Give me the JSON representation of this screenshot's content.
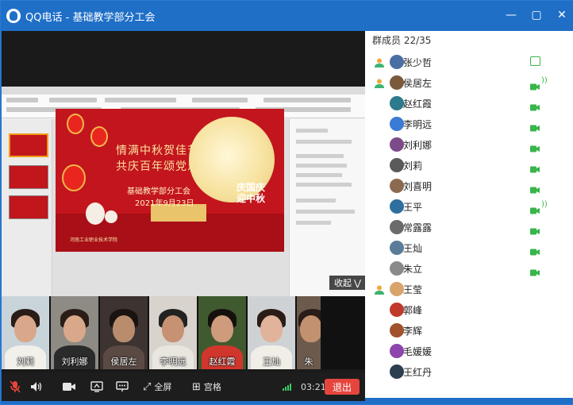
{
  "window": {
    "app_name": "QQ电话",
    "separator": " - ",
    "group_name": "基础教学部分工会"
  },
  "slide": {
    "line1": "情满中秋贺佳节",
    "line2": "共庆百年颂党恩",
    "line3": "基础教学部分工会",
    "line4": "2021年9月23日",
    "stamp": "庆国庆 迎中秋",
    "footer": "河南工业职业技术学院"
  },
  "share": {
    "collapse_label": "收起"
  },
  "video_tiles": [
    {
      "name": "刘莉"
    },
    {
      "name": "刘利娜"
    },
    {
      "name": "侯居左"
    },
    {
      "name": "李明远"
    },
    {
      "name": "赵红霞"
    },
    {
      "name": "王灿"
    },
    {
      "name": "朱"
    }
  ],
  "toolbar": {
    "fullscreen_label": "全屏",
    "grid_label": "宫格",
    "timer": "03:21",
    "exit_label": "退出"
  },
  "members": {
    "header": "群成员 22/35",
    "list": [
      {
        "name": "张少哲",
        "role": "admin",
        "status": "screen"
      },
      {
        "name": "侯居左",
        "role": "admin",
        "status": "cam-speaking"
      },
      {
        "name": "赵红霞",
        "role": "",
        "status": "cam"
      },
      {
        "name": "李明远",
        "role": "",
        "status": "cam"
      },
      {
        "name": "刘利娜",
        "role": "",
        "status": "cam"
      },
      {
        "name": "刘莉",
        "role": "",
        "status": "cam"
      },
      {
        "name": "刘喜明",
        "role": "",
        "status": "cam"
      },
      {
        "name": "王平",
        "role": "",
        "status": "cam-speaking"
      },
      {
        "name": "常露露",
        "role": "",
        "status": "cam"
      },
      {
        "name": "王灿",
        "role": "",
        "status": "cam"
      },
      {
        "name": "朱立",
        "role": "",
        "status": "cam"
      },
      {
        "name": "王莹",
        "role": "admin",
        "status": ""
      },
      {
        "name": "郭峰",
        "role": "",
        "status": ""
      },
      {
        "name": "李辉",
        "role": "",
        "status": ""
      },
      {
        "name": "毛媛媛",
        "role": "",
        "status": ""
      },
      {
        "name": "王红丹",
        "role": "",
        "status": ""
      }
    ]
  },
  "colors": {
    "titlebar": "#1f6fc7",
    "accent_green": "#39b54a",
    "exit_red": "#e6453d",
    "slide_red": "#c3151d"
  }
}
